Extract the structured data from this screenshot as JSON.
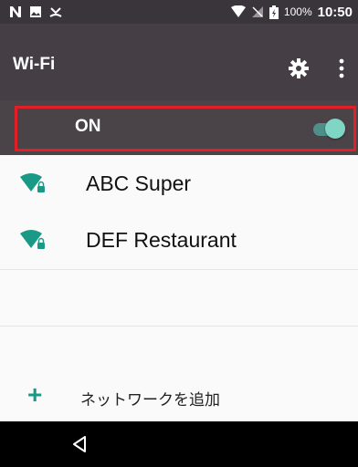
{
  "status_bar": {
    "battery_percent": "100%",
    "time": "10:50",
    "left_icons": [
      "notification-n-icon",
      "image-icon",
      "missed-call-icon"
    ],
    "right_icons": [
      "wifi-signal-icon",
      "no-sim-icon",
      "battery-charging-icon"
    ]
  },
  "toolbar": {
    "title": "Wi-Fi",
    "icons": [
      "gear-icon",
      "more-vert-icon"
    ]
  },
  "wifi_toggle": {
    "label": "ON",
    "state": "on"
  },
  "networks": [
    {
      "name": "ABC Super",
      "secured": true
    },
    {
      "name": "DEF Restaurant",
      "secured": true
    }
  ],
  "add_network": {
    "icon": "plus-icon",
    "label": "ネットワークを追加"
  },
  "nav_bar": {
    "icons": [
      "back-icon"
    ]
  },
  "colors": {
    "toolbar_bg": "#453e45",
    "toggle_row_bg": "#4a4348",
    "accent": "#1a9a86",
    "highlight": "#e21f26"
  }
}
